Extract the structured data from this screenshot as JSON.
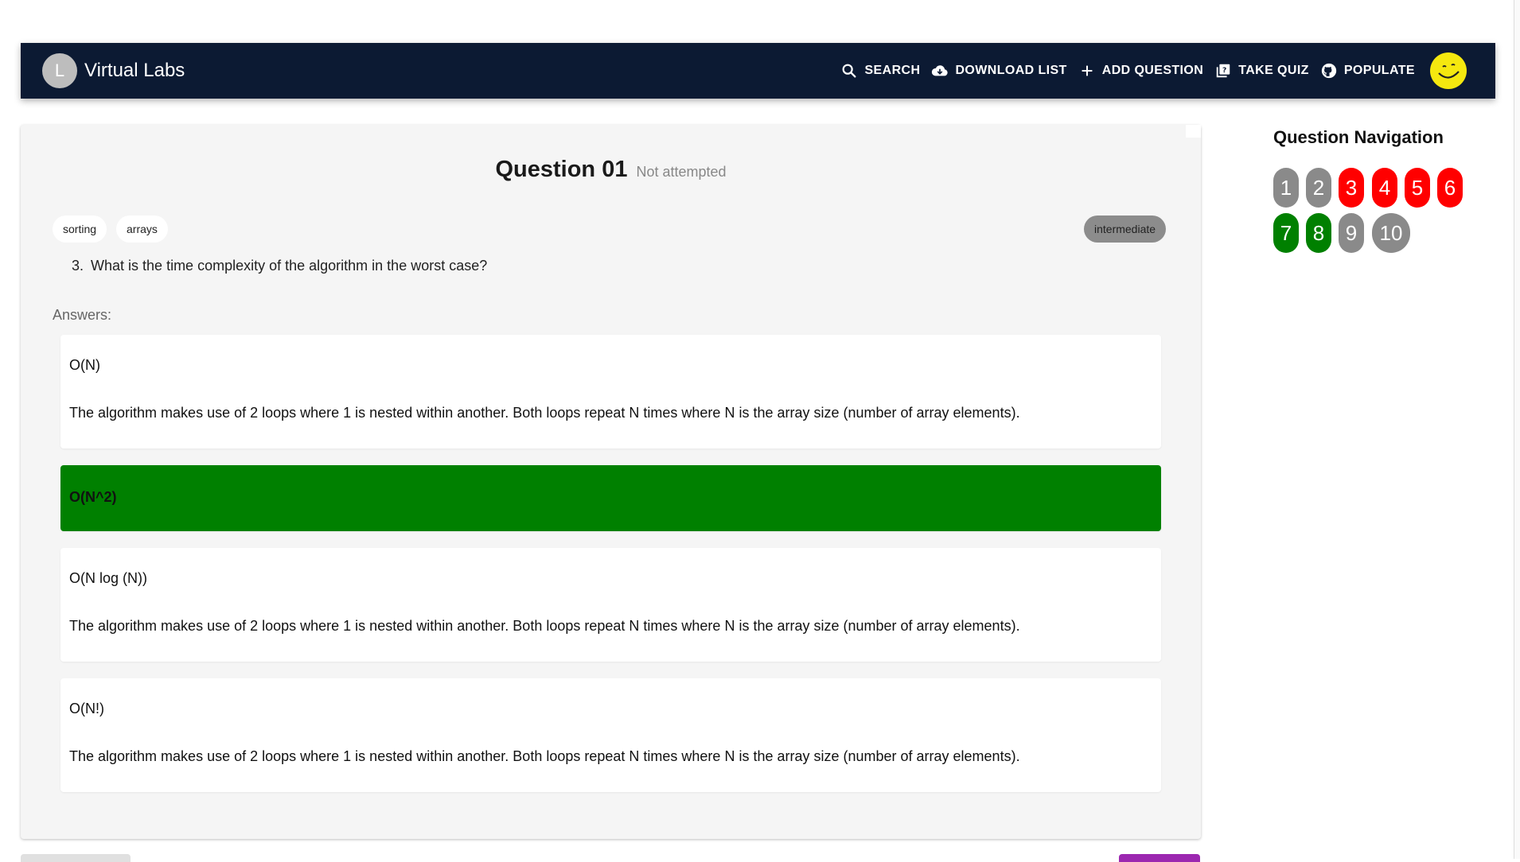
{
  "header": {
    "brand_initial": "L",
    "brand_title": "Virtual Labs",
    "actions": [
      {
        "label": "SEARCH",
        "icon": "search-icon"
      },
      {
        "label": "DOWNLOAD LIST",
        "icon": "cloud-download-icon"
      },
      {
        "label": "ADD QUESTION",
        "icon": "plus-icon"
      },
      {
        "label": "TAKE QUIZ",
        "icon": "quiz-icon"
      },
      {
        "label": "POPULATE",
        "icon": "github-icon"
      }
    ],
    "user_avatar": "smiley-avatar-icon"
  },
  "question": {
    "title": "Question 01",
    "status": "Not attempted",
    "tags": [
      "sorting",
      "arrays"
    ],
    "difficulty": "intermediate",
    "number": "3.",
    "text": "What is the time complexity of the algorithm in the worst case?",
    "answers_label": "Answers:",
    "answers": [
      {
        "option": "O(N)",
        "explanation": "The algorithm makes use of 2 loops where 1 is nested within another. Both loops repeat N times where N is the array size (number of array elements)."
      },
      {
        "option": "O(N^2)",
        "explanation": "",
        "correct": true
      },
      {
        "option": "O(N log (N))",
        "explanation": "The algorithm makes use of 2 loops where 1 is nested within another. Both loops repeat N times where N is the array size (number of array elements)."
      },
      {
        "option": "O(N!)",
        "explanation": "The algorithm makes use of 2 loops where 1 is nested within another. Both loops repeat N times where N is the array size (number of array elements)."
      }
    ]
  },
  "navigation": {
    "title": "Question Navigation",
    "items": [
      {
        "label": "1",
        "color": "#8a8a8a"
      },
      {
        "label": "2",
        "color": "#8a8a8a"
      },
      {
        "label": "3",
        "color": "#ff0000"
      },
      {
        "label": "4",
        "color": "#ff0000"
      },
      {
        "label": "5",
        "color": "#ff0000"
      },
      {
        "label": "6",
        "color": "#ff0000"
      },
      {
        "label": "7",
        "color": "#008000"
      },
      {
        "label": "8",
        "color": "#008000"
      },
      {
        "label": "9",
        "color": "#8a8a8a"
      },
      {
        "label": "10",
        "color": "#8a8a8a"
      }
    ]
  },
  "colors": {
    "appbar": "#0c1a33",
    "correct": "#008000",
    "incorrect": "#ff0000",
    "neutral": "#8a8a8a",
    "accent": "#9c27b0"
  }
}
